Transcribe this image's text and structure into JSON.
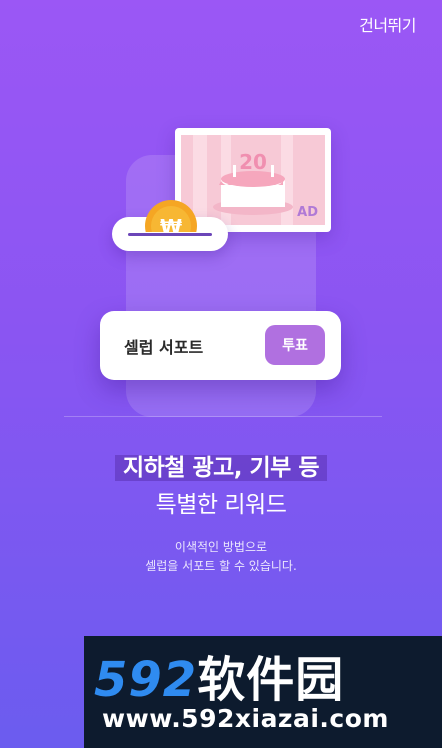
{
  "header": {
    "skip_label": "건너뛰기"
  },
  "illustration": {
    "ad_cake_number": "20",
    "ad_label": "AD",
    "coin_symbol": "₩",
    "support_card_text": "셀럽 서포트",
    "vote_button_label": "투표"
  },
  "content": {
    "headline": "지하철 광고, 기부 등",
    "subheadline": "특별한 리워드",
    "description_line1": "이색적인 방법으로",
    "description_line2": "셀럽을 서포트 할 수 있습니다."
  },
  "watermark": {
    "logo_digits": "592",
    "logo_cn": "软件园",
    "url": "www.592xiazai.com"
  },
  "colors": {
    "background_top": "#9b57f5",
    "background_bottom": "#6b5cef",
    "accent_button": "#b070e0",
    "coin": "#f5a623"
  }
}
